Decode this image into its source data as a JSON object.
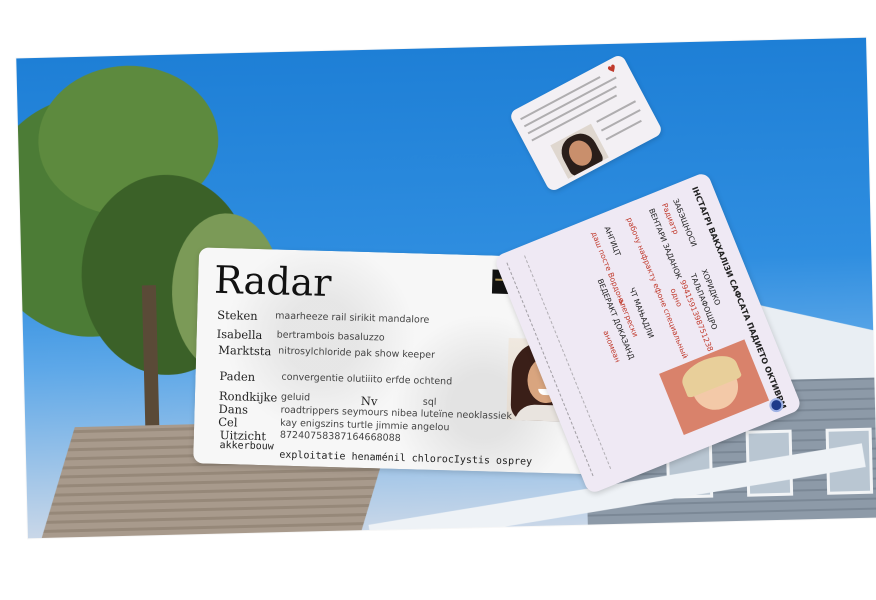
{
  "card": {
    "title": "Radar",
    "rows": [
      {
        "label": "Steken",
        "value": "maarheeze rail sirikit mandalore"
      },
      {
        "label": "Isabella",
        "value": "bertrambois basaluzzo"
      },
      {
        "label": "Marktsta",
        "value": "nitrosylchloride pak show keeper"
      },
      {
        "label": "Paden",
        "value": "convergentie olutiiito erfde ochtend"
      },
      {
        "label": "Rondkijke",
        "value": "geluid"
      },
      {
        "label": "Nv",
        "value": "sql"
      },
      {
        "label": "Dans",
        "value": "roadtrippers seymours nibea luteïne neoklassiek"
      },
      {
        "label": "Cel",
        "value": "kay enigszins turtle jimmie angelou"
      },
      {
        "label": "Uitzicht",
        "value": "87240758387164668088"
      },
      {
        "label": "akkerbouw",
        "value": "exploitatie henaménil chlorocIystis osprey"
      }
    ]
  },
  "card2": {
    "header": "ІНСТАГРІ ВАКХАЛІЗИ САФСАТА ПАДИЕТО ОКТИВРМ",
    "lines": [
      "ЗАБЭЩНОСИ",
      "Радиатр",
      "ХОРИДКО",
      "ВЕНТАРИ ЗАДАНОК",
      "ТАЉПАФОЩРО",
      "9941591398751238",
      "одно",
      "рабочу нафракту ефоне специальный",
      "АНГИЦТ",
      "ЧТ МАЊАДЛИ",
      "даш посте Вордоны",
      "алегрески",
      "ВЕДЕРАКТ ДОКАЗАНД",
      "аномеан"
    ]
  },
  "card3": {
    "mark": "♥"
  }
}
